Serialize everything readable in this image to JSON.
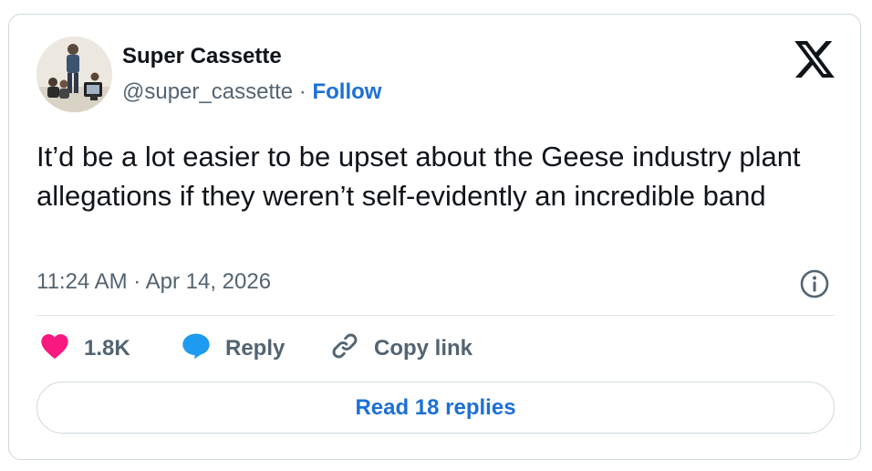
{
  "user": {
    "display_name": "Super Cassette",
    "handle": "@super_cassette",
    "separator": " · ",
    "follow_label": "Follow"
  },
  "tweet": {
    "text": "It’d be a lot easier to be upset about the Geese industry plant allegations if they weren’t self-evidently an incredible band",
    "timestamp": "11:24 AM · Apr 14, 2026"
  },
  "actions": {
    "like_count": "1.8K",
    "reply_label": "Reply",
    "copy_link_label": "Copy link"
  },
  "footer": {
    "read_replies_label": "Read 18 replies"
  },
  "icons": {
    "brand": "x-logo-icon",
    "info": "info-icon",
    "like": "heart-icon",
    "reply": "speech-bubble-icon",
    "copy": "link-icon"
  },
  "colors": {
    "like": "#f91880",
    "reply": "#1d9bf0",
    "link": "#1d6fd6",
    "text": "#0f1419",
    "muted": "#536471",
    "border": "#cfd9de"
  }
}
